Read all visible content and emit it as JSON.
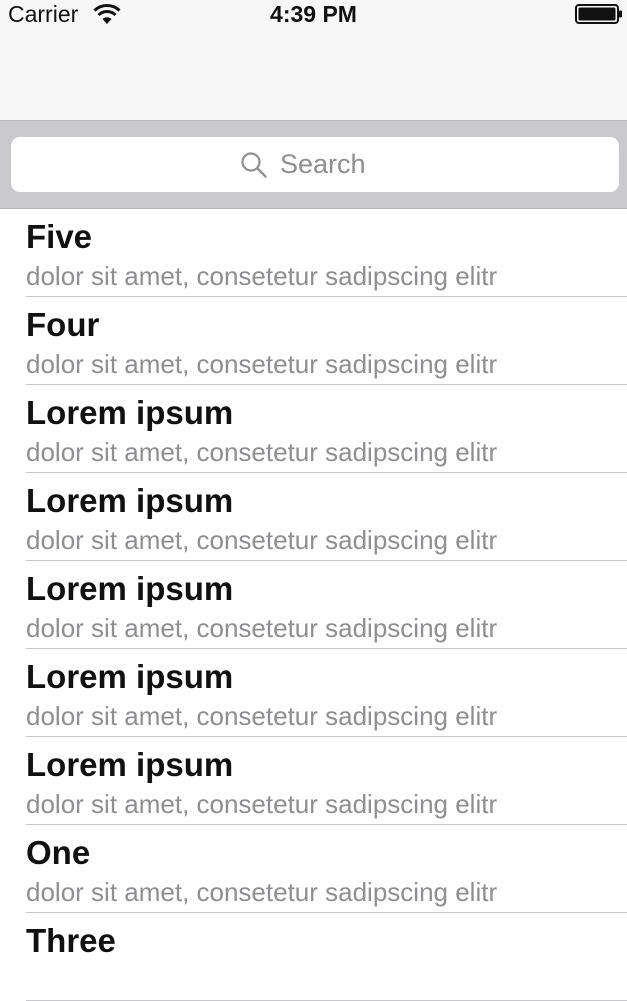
{
  "status_bar": {
    "carrier": "Carrier",
    "time": "4:39 PM",
    "icons": [
      "wifi-icon",
      "battery-icon"
    ]
  },
  "search": {
    "placeholder": "Search",
    "value": "",
    "icon": "search-icon"
  },
  "list": {
    "items": [
      {
        "title": "Five",
        "subtitle": "dolor sit amet, consetetur sadipscing elitr"
      },
      {
        "title": "Four",
        "subtitle": "dolor sit amet, consetetur sadipscing elitr"
      },
      {
        "title": "Lorem ipsum",
        "subtitle": "dolor sit amet, consetetur sadipscing elitr"
      },
      {
        "title": "Lorem ipsum",
        "subtitle": "dolor sit amet, consetetur sadipscing elitr"
      },
      {
        "title": "Lorem ipsum",
        "subtitle": "dolor sit amet, consetetur sadipscing elitr"
      },
      {
        "title": "Lorem ipsum",
        "subtitle": "dolor sit amet, consetetur sadipscing elitr"
      },
      {
        "title": "Lorem ipsum",
        "subtitle": "dolor sit amet, consetetur sadipscing elitr"
      },
      {
        "title": "One",
        "subtitle": "dolor sit amet, consetetur sadipscing elitr"
      },
      {
        "title": "Three",
        "subtitle": ""
      }
    ]
  },
  "colors": {
    "navbar_bg": "#f7f7f8",
    "searchbar_bg": "#c9c9ce",
    "subtitle_text": "#8e8e93",
    "separator": "#c8c7cc"
  }
}
